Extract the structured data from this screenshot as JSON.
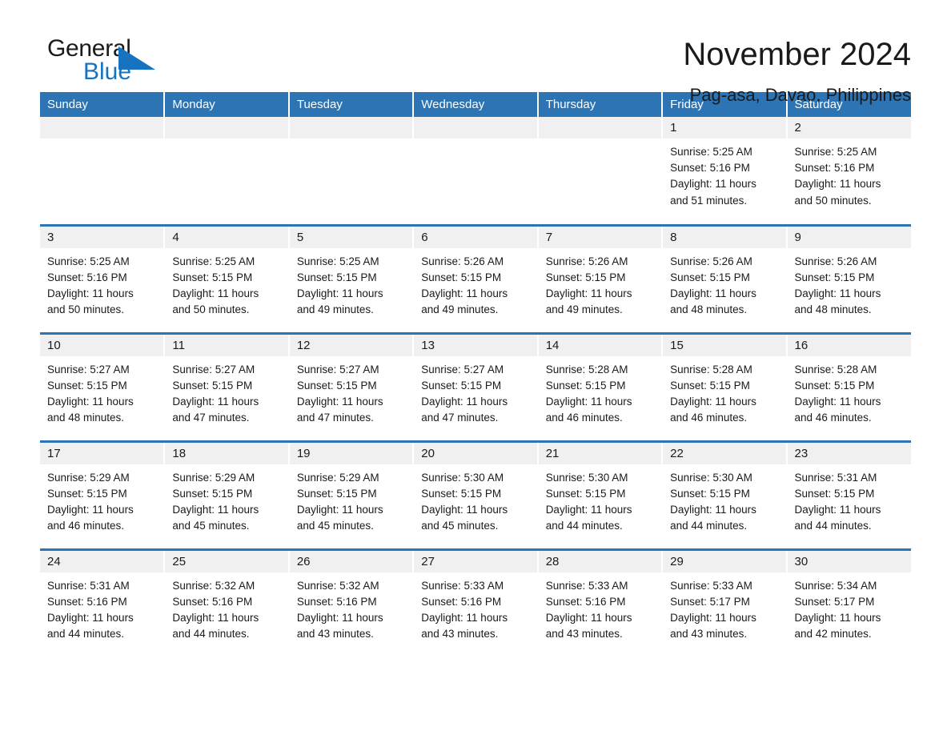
{
  "logo": {
    "word1": "General",
    "word2": "Blue",
    "triangle_color": "#1773c0",
    "text_color": "#1b1b1b"
  },
  "header": {
    "title": "November 2024",
    "subtitle": "Pag-asa, Davao, Philippines"
  },
  "theme": {
    "header_blue": "#2c74b3",
    "daynum_band": "#f0f0f0",
    "row_divider": "#2c74b3"
  },
  "weekday_headers": [
    "Sunday",
    "Monday",
    "Tuesday",
    "Wednesday",
    "Thursday",
    "Friday",
    "Saturday"
  ],
  "weeks": [
    [
      {
        "day": "",
        "lines": []
      },
      {
        "day": "",
        "lines": []
      },
      {
        "day": "",
        "lines": []
      },
      {
        "day": "",
        "lines": []
      },
      {
        "day": "",
        "lines": []
      },
      {
        "day": "1",
        "lines": [
          "Sunrise: 5:25 AM",
          "Sunset: 5:16 PM",
          "Daylight: 11 hours",
          "and 51 minutes."
        ]
      },
      {
        "day": "2",
        "lines": [
          "Sunrise: 5:25 AM",
          "Sunset: 5:16 PM",
          "Daylight: 11 hours",
          "and 50 minutes."
        ]
      }
    ],
    [
      {
        "day": "3",
        "lines": [
          "Sunrise: 5:25 AM",
          "Sunset: 5:16 PM",
          "Daylight: 11 hours",
          "and 50 minutes."
        ]
      },
      {
        "day": "4",
        "lines": [
          "Sunrise: 5:25 AM",
          "Sunset: 5:15 PM",
          "Daylight: 11 hours",
          "and 50 minutes."
        ]
      },
      {
        "day": "5",
        "lines": [
          "Sunrise: 5:25 AM",
          "Sunset: 5:15 PM",
          "Daylight: 11 hours",
          "and 49 minutes."
        ]
      },
      {
        "day": "6",
        "lines": [
          "Sunrise: 5:26 AM",
          "Sunset: 5:15 PM",
          "Daylight: 11 hours",
          "and 49 minutes."
        ]
      },
      {
        "day": "7",
        "lines": [
          "Sunrise: 5:26 AM",
          "Sunset: 5:15 PM",
          "Daylight: 11 hours",
          "and 49 minutes."
        ]
      },
      {
        "day": "8",
        "lines": [
          "Sunrise: 5:26 AM",
          "Sunset: 5:15 PM",
          "Daylight: 11 hours",
          "and 48 minutes."
        ]
      },
      {
        "day": "9",
        "lines": [
          "Sunrise: 5:26 AM",
          "Sunset: 5:15 PM",
          "Daylight: 11 hours",
          "and 48 minutes."
        ]
      }
    ],
    [
      {
        "day": "10",
        "lines": [
          "Sunrise: 5:27 AM",
          "Sunset: 5:15 PM",
          "Daylight: 11 hours",
          "and 48 minutes."
        ]
      },
      {
        "day": "11",
        "lines": [
          "Sunrise: 5:27 AM",
          "Sunset: 5:15 PM",
          "Daylight: 11 hours",
          "and 47 minutes."
        ]
      },
      {
        "day": "12",
        "lines": [
          "Sunrise: 5:27 AM",
          "Sunset: 5:15 PM",
          "Daylight: 11 hours",
          "and 47 minutes."
        ]
      },
      {
        "day": "13",
        "lines": [
          "Sunrise: 5:27 AM",
          "Sunset: 5:15 PM",
          "Daylight: 11 hours",
          "and 47 minutes."
        ]
      },
      {
        "day": "14",
        "lines": [
          "Sunrise: 5:28 AM",
          "Sunset: 5:15 PM",
          "Daylight: 11 hours",
          "and 46 minutes."
        ]
      },
      {
        "day": "15",
        "lines": [
          "Sunrise: 5:28 AM",
          "Sunset: 5:15 PM",
          "Daylight: 11 hours",
          "and 46 minutes."
        ]
      },
      {
        "day": "16",
        "lines": [
          "Sunrise: 5:28 AM",
          "Sunset: 5:15 PM",
          "Daylight: 11 hours",
          "and 46 minutes."
        ]
      }
    ],
    [
      {
        "day": "17",
        "lines": [
          "Sunrise: 5:29 AM",
          "Sunset: 5:15 PM",
          "Daylight: 11 hours",
          "and 46 minutes."
        ]
      },
      {
        "day": "18",
        "lines": [
          "Sunrise: 5:29 AM",
          "Sunset: 5:15 PM",
          "Daylight: 11 hours",
          "and 45 minutes."
        ]
      },
      {
        "day": "19",
        "lines": [
          "Sunrise: 5:29 AM",
          "Sunset: 5:15 PM",
          "Daylight: 11 hours",
          "and 45 minutes."
        ]
      },
      {
        "day": "20",
        "lines": [
          "Sunrise: 5:30 AM",
          "Sunset: 5:15 PM",
          "Daylight: 11 hours",
          "and 45 minutes."
        ]
      },
      {
        "day": "21",
        "lines": [
          "Sunrise: 5:30 AM",
          "Sunset: 5:15 PM",
          "Daylight: 11 hours",
          "and 44 minutes."
        ]
      },
      {
        "day": "22",
        "lines": [
          "Sunrise: 5:30 AM",
          "Sunset: 5:15 PM",
          "Daylight: 11 hours",
          "and 44 minutes."
        ]
      },
      {
        "day": "23",
        "lines": [
          "Sunrise: 5:31 AM",
          "Sunset: 5:15 PM",
          "Daylight: 11 hours",
          "and 44 minutes."
        ]
      }
    ],
    [
      {
        "day": "24",
        "lines": [
          "Sunrise: 5:31 AM",
          "Sunset: 5:16 PM",
          "Daylight: 11 hours",
          "and 44 minutes."
        ]
      },
      {
        "day": "25",
        "lines": [
          "Sunrise: 5:32 AM",
          "Sunset: 5:16 PM",
          "Daylight: 11 hours",
          "and 44 minutes."
        ]
      },
      {
        "day": "26",
        "lines": [
          "Sunrise: 5:32 AM",
          "Sunset: 5:16 PM",
          "Daylight: 11 hours",
          "and 43 minutes."
        ]
      },
      {
        "day": "27",
        "lines": [
          "Sunrise: 5:33 AM",
          "Sunset: 5:16 PM",
          "Daylight: 11 hours",
          "and 43 minutes."
        ]
      },
      {
        "day": "28",
        "lines": [
          "Sunrise: 5:33 AM",
          "Sunset: 5:16 PM",
          "Daylight: 11 hours",
          "and 43 minutes."
        ]
      },
      {
        "day": "29",
        "lines": [
          "Sunrise: 5:33 AM",
          "Sunset: 5:17 PM",
          "Daylight: 11 hours",
          "and 43 minutes."
        ]
      },
      {
        "day": "30",
        "lines": [
          "Sunrise: 5:34 AM",
          "Sunset: 5:17 PM",
          "Daylight: 11 hours",
          "and 42 minutes."
        ]
      }
    ]
  ]
}
